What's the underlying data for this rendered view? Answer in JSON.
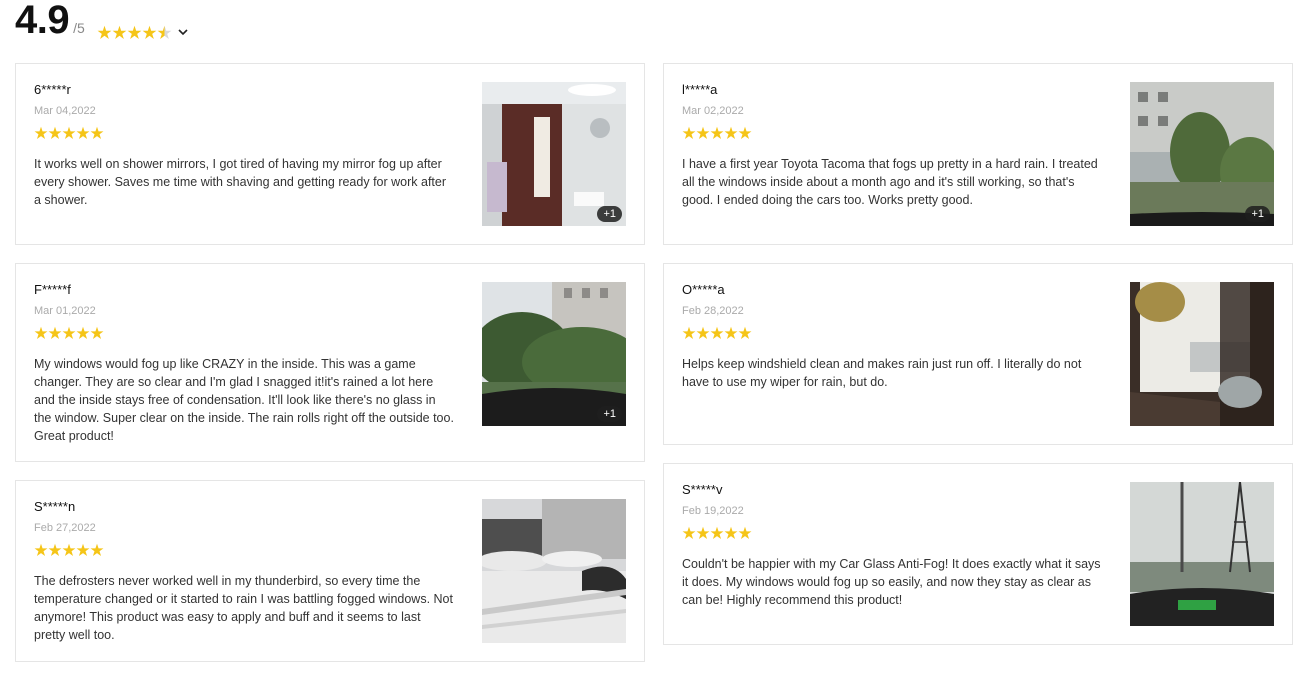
{
  "summary": {
    "score": "4.9",
    "outof": "/5",
    "rating": 4.5
  },
  "colors": {
    "star": "#f5c518",
    "star_empty": "#d9d9d9"
  },
  "reviews_left": [
    {
      "name": "6*****r",
      "date": "Mar 04,2022",
      "stars": 5,
      "text": "It works well on shower mirrors, I got tired of having my mirror fog up after every shower. Saves me time with shaving and getting ready for work after a shower.",
      "badge": "+1",
      "photo": "shower-mirror"
    },
    {
      "name": "F*****f",
      "date": "Mar 01,2022",
      "stars": 5,
      "text": "My windows would fog up like CRAZY in the inside. This was a game changer. They are so clear and I'm glad I snagged it!it's rained a lot here and the inside stays free of condensation. It'll look like there's no glass in the window. Super clear on the inside. The rain rolls right off the outside too. Great product!",
      "badge": "+1",
      "photo": "trees-windshield"
    },
    {
      "name": "S*****n",
      "date": "Feb 27,2022",
      "stars": 5,
      "text": "The defrosters never worked well in my thunderbird, so every time the temperature changed or it started to rain I was battling fogged windows. Not anymore! This product was easy to apply and buff and it seems to last pretty well too.",
      "badge": "",
      "photo": "snow-car"
    }
  ],
  "reviews_right": [
    {
      "name": "l*****a",
      "date": "Mar 02,2022",
      "stars": 5,
      "text": "I have a first year Toyota Tacoma that fogs up pretty in a hard rain. I treated all the windows inside about a month ago and it's still working, so that's good. I ended doing the cars too. Works pretty good.",
      "badge": "+1",
      "photo": "building-trees"
    },
    {
      "name": "O*****a",
      "date": "Feb 28,2022",
      "stars": 5,
      "text": "Helps keep windshield clean and makes rain just run off. I literally do not have to use my wiper for rain, but do.",
      "badge": "",
      "photo": "truck-side"
    },
    {
      "name": "S*****v",
      "date": "Feb 19,2022",
      "stars": 5,
      "text": "Couldn't be happier with my Car Glass Anti-Fog! It does exactly what it says it does. My windows would fog up so easily, and now they stay as clear as can be! Highly recommend this product!",
      "badge": "",
      "photo": "foggy-road"
    }
  ]
}
